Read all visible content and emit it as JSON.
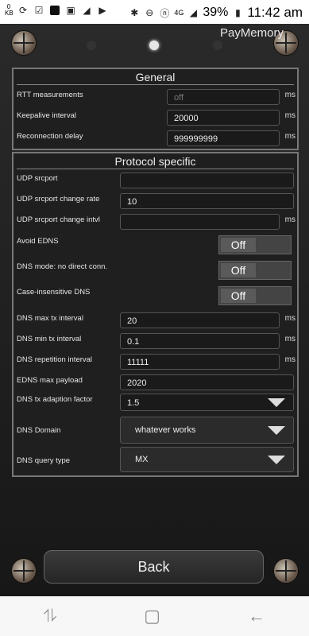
{
  "status_bar": {
    "kb_top": "0",
    "kb_bottom": "KB",
    "signal": "4G",
    "battery": "39%",
    "time": "11:42 am"
  },
  "app": {
    "title": "PayMemory"
  },
  "general": {
    "title": "General",
    "rows": [
      {
        "label": "RTT measurements",
        "value": "off",
        "unit": "ms"
      },
      {
        "label": "Keepalive interval",
        "value": "20000",
        "unit": "ms"
      },
      {
        "label": "Reconnection delay",
        "value": "999999999",
        "unit": "ms"
      }
    ]
  },
  "protocol": {
    "title": "Protocol specific",
    "udp_srcport": {
      "label": "UDP srcport",
      "value": ""
    },
    "udp_change_rate": {
      "label": "UDP srcport change rate",
      "value": "10"
    },
    "udp_change_intvl": {
      "label": "UDP srcport change intvl",
      "value": "",
      "unit": "ms"
    },
    "avoid_edns": {
      "label": "Avoid EDNS",
      "state": "Off"
    },
    "no_direct": {
      "label": "DNS mode: no direct conn.",
      "state": "Off"
    },
    "case_insensitive": {
      "label": "Case-insensitive DNS",
      "state": "Off"
    },
    "max_tx": {
      "label": "DNS max tx interval",
      "value": "20",
      "unit": "ms"
    },
    "min_tx": {
      "label": "DNS min tx interval",
      "value": "0.1",
      "unit": "ms"
    },
    "repetition": {
      "label": "DNS repetition interval",
      "value": "11111",
      "unit": "ms"
    },
    "edns_payload": {
      "label": "EDNS max payload",
      "value": "2020"
    },
    "adaption": {
      "label": "DNS tx adaption factor",
      "value": "1.5"
    },
    "domain": {
      "label": "DNS Domain",
      "value": "whatever works"
    },
    "query_type": {
      "label": "DNS query type",
      "value": "MX"
    }
  },
  "back_button": "Back"
}
